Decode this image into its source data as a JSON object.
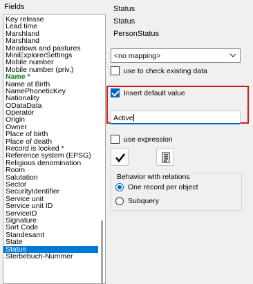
{
  "fields_group": {
    "title": "Fields",
    "items": [
      {
        "label": "Key release",
        "required": false,
        "selected": false
      },
      {
        "label": "Lead time",
        "required": false,
        "selected": false
      },
      {
        "label": "Marshland",
        "required": false,
        "selected": false
      },
      {
        "label": "Marshland",
        "required": false,
        "selected": false
      },
      {
        "label": "Meadows and pastures",
        "required": false,
        "selected": false
      },
      {
        "label": "MiniExplorerSettings",
        "required": false,
        "selected": false
      },
      {
        "label": "Mobile number",
        "required": false,
        "selected": false
      },
      {
        "label": "Mobile number (priv.)",
        "required": false,
        "selected": false
      },
      {
        "label": "Name *",
        "required": true,
        "selected": false
      },
      {
        "label": "Name at Birth",
        "required": false,
        "selected": false
      },
      {
        "label": "NamePhoneticKey",
        "required": false,
        "selected": false
      },
      {
        "label": "Nationality",
        "required": false,
        "selected": false
      },
      {
        "label": "ODataData",
        "required": false,
        "selected": false
      },
      {
        "label": "Operator",
        "required": false,
        "selected": false
      },
      {
        "label": "Origin",
        "required": false,
        "selected": false
      },
      {
        "label": "Owner",
        "required": false,
        "selected": false
      },
      {
        "label": "Place of birth",
        "required": false,
        "selected": false
      },
      {
        "label": "Place of death",
        "required": false,
        "selected": false
      },
      {
        "label": "Record is locked *",
        "required": false,
        "selected": false
      },
      {
        "label": "Reference system (EPSG)",
        "required": false,
        "selected": false
      },
      {
        "label": "Religious denomination",
        "required": false,
        "selected": false
      },
      {
        "label": "Room",
        "required": false,
        "selected": false
      },
      {
        "label": "Salutation",
        "required": false,
        "selected": false
      },
      {
        "label": "Sector",
        "required": false,
        "selected": false
      },
      {
        "label": "SecurityIdentifier",
        "required": false,
        "selected": false
      },
      {
        "label": "Service unit",
        "required": false,
        "selected": false
      },
      {
        "label": "Service unit ID",
        "required": false,
        "selected": false
      },
      {
        "label": "ServiceID",
        "required": false,
        "selected": false
      },
      {
        "label": "Signature",
        "required": false,
        "selected": false
      },
      {
        "label": "Sort Code",
        "required": false,
        "selected": false
      },
      {
        "label": "Standesamt",
        "required": false,
        "selected": false
      },
      {
        "label": "State",
        "required": false,
        "selected": false
      },
      {
        "label": "Status",
        "required": false,
        "selected": true
      },
      {
        "label": "Sterbebuch-Nummer",
        "required": false,
        "selected": false
      }
    ]
  },
  "field_info": {
    "display_name": "Status",
    "caption": "Status",
    "internal_name": "PersonStatus"
  },
  "mapping": {
    "selected": "<no mapping>"
  },
  "options": {
    "check_existing_label": "use to check existing data",
    "check_existing": false,
    "insert_default_label": "Insert default value",
    "insert_default": true,
    "default_value": "Active",
    "use_expression_label": "use expression",
    "use_expression": false
  },
  "buttons": {
    "check_icon": "checkmark-icon",
    "text_icon": "document-lines-icon"
  },
  "relations": {
    "legend": "Behavior with relations",
    "options": [
      {
        "label": "One record per object",
        "checked": true
      },
      {
        "label": "Subquery",
        "checked": false
      }
    ]
  },
  "colors": {
    "selection": "#0078d7",
    "required_text": "#137a13",
    "highlight_border": "#d21a1a",
    "accent": "#0067c0"
  }
}
